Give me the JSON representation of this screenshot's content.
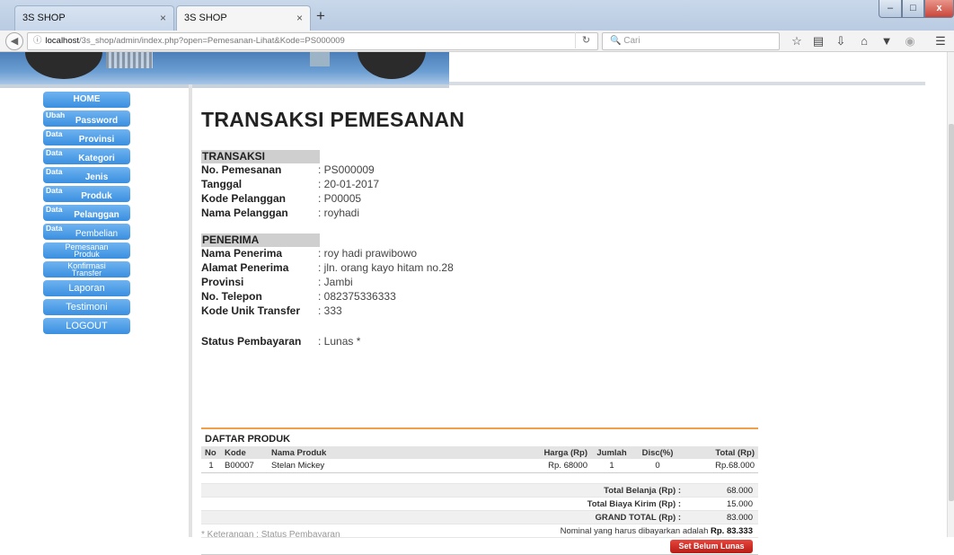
{
  "browser": {
    "tabs": [
      {
        "title": "3S SHOP",
        "close": "×"
      },
      {
        "title": "3S SHOP",
        "close": "×"
      }
    ],
    "new_tab": "+",
    "window_controls": {
      "minimize": "–",
      "maximize": "□",
      "close": "x"
    },
    "url_host": "localhost",
    "url_path": "/3s_shop/admin/index.php?open=Pemesanan-Lihat&Kode=PS000009",
    "search_placeholder": "Cari",
    "toolbar_icons": [
      "star-icon",
      "reading-list-icon",
      "download-icon",
      "home-icon",
      "pocket-icon",
      "addon-icon",
      "menu-icon"
    ]
  },
  "sidebar": {
    "items": [
      {
        "pre": "",
        "main": "HOME"
      },
      {
        "pre": "Ubah",
        "main": "Password"
      },
      {
        "pre": "Data",
        "main": "Provinsi"
      },
      {
        "pre": "Data",
        "main": "Kategori"
      },
      {
        "pre": "Data",
        "main": "Jenis"
      },
      {
        "pre": "Data",
        "main": "Produk"
      },
      {
        "pre": "Data",
        "main": "Pelanggan"
      },
      {
        "pre": "Data",
        "main": "Pembelian"
      },
      {
        "line1": "Pemesanan",
        "line2": "Produk"
      },
      {
        "line1": "Konfirmasi",
        "line2": "Transfer"
      },
      {
        "main": "Laporan"
      },
      {
        "main": "Testimoni"
      },
      {
        "main": "LOGOUT"
      }
    ]
  },
  "page": {
    "title": "TRANSAKSI PEMESANAN",
    "transaksi": {
      "header": "TRANSAKSI",
      "rows": [
        {
          "label": "No. Pemesanan",
          "value": ": PS000009"
        },
        {
          "label": "Tanggal",
          "value": ": 20-01-2017"
        },
        {
          "label": "Kode Pelanggan",
          "value": ": P00005"
        },
        {
          "label": "Nama Pelanggan",
          "value": ": royhadi"
        }
      ]
    },
    "penerima": {
      "header": "PENERIMA",
      "rows": [
        {
          "label": "Nama Penerima",
          "value": ": roy hadi prawibowo"
        },
        {
          "label": "Alamat Penerima",
          "value": ": jln. orang kayo hitam no.28"
        },
        {
          "label": "Provinsi",
          "value": ": Jambi"
        },
        {
          "label": "No. Telepon",
          "value": ": 082375336333"
        },
        {
          "label": "Kode Unik Transfer",
          "value": ": 333"
        }
      ]
    },
    "status": {
      "label": "Status Pembayaran",
      "value": ": Lunas *"
    },
    "products": {
      "title": "DAFTAR PRODUK",
      "columns": [
        "No",
        "Kode",
        "Nama Produk",
        "Harga (Rp)",
        "Jumlah",
        "Disc(%)",
        "Total (Rp)"
      ],
      "rows": [
        [
          "1",
          "B00007",
          "Stelan Mickey",
          "Rp. 68000",
          "1",
          "0",
          "Rp.68.000"
        ]
      ]
    },
    "summary": [
      {
        "label": "Total Belanja (Rp) :",
        "value": "68.000"
      },
      {
        "label": "Total Biaya Kirim (Rp) :",
        "value": "15.000"
      },
      {
        "label": "GRAND TOTAL (Rp) :",
        "value": "83.000"
      }
    ],
    "nominal_text": "Nominal yang harus dibayarkan adalah",
    "nominal_value": "Rp. 83.333",
    "set_button": "Set Belum Lunas",
    "footer_cut": "* Keterangan : Status Pembayaran"
  }
}
